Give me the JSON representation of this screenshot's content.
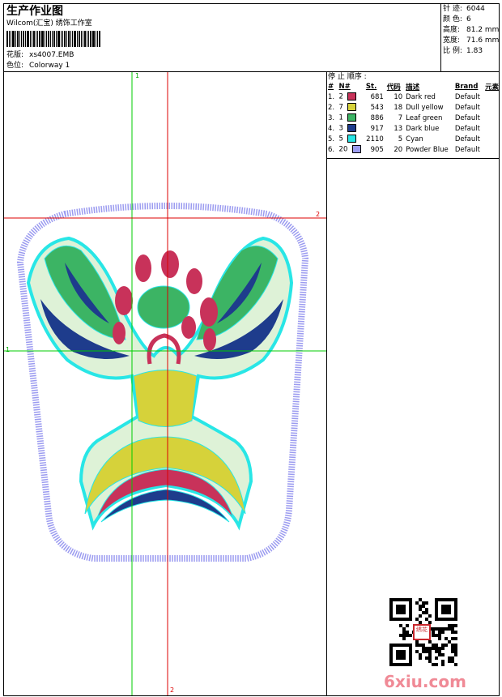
{
  "header": {
    "title": "生产作业图",
    "subtitle": "Wilcom(汇宝) 绣饰工作室",
    "design_label": "花版:",
    "design_value": "xs4007.EMB",
    "colorway_label": "色位:",
    "colorway_value": "Colorway 1"
  },
  "stats": [
    {
      "label": "针 迹:",
      "value": "6044"
    },
    {
      "label": "颜 色:",
      "value": "6"
    },
    {
      "label": "高度:",
      "value": "81.2 mm"
    },
    {
      "label": "宽度:",
      "value": "71.6 mm"
    },
    {
      "label": "比 例:",
      "value": "1.83"
    }
  ],
  "stop_sequence": {
    "title": "停 止 顺序 :",
    "columns": [
      "#",
      "N#",
      "St.",
      "代码",
      "描述",
      "Brand",
      "元素"
    ],
    "rows": [
      {
        "idx": "1.",
        "n": "2",
        "color": "#c8325a",
        "st": "681",
        "code": "10",
        "desc": "Dark red",
        "brand": "Default"
      },
      {
        "idx": "2.",
        "n": "7",
        "color": "#d6d23a",
        "st": "543",
        "code": "18",
        "desc": "Dull yellow",
        "brand": "Default"
      },
      {
        "idx": "3.",
        "n": "1",
        "color": "#3cb464",
        "st": "886",
        "code": "7",
        "desc": "Leaf green",
        "brand": "Default"
      },
      {
        "idx": "4.",
        "n": "3",
        "color": "#1e3c8c",
        "st": "917",
        "code": "13",
        "desc": "Dark blue",
        "brand": "Default"
      },
      {
        "idx": "5.",
        "n": "5",
        "color": "#28e6e6",
        "st": "2110",
        "code": "5",
        "desc": "Cyan",
        "brand": "Default"
      },
      {
        "idx": "6.",
        "n": "20",
        "color": "#9b9bf0",
        "st": "905",
        "code": "20",
        "desc": "Powder Blue",
        "brand": "Default"
      }
    ]
  },
  "guides": {
    "green_label": "1",
    "red_label": "2",
    "green_color": "#00cc00",
    "red_color": "#dd0000"
  },
  "watermark": "6xiu.com",
  "seal_text": "绣花"
}
